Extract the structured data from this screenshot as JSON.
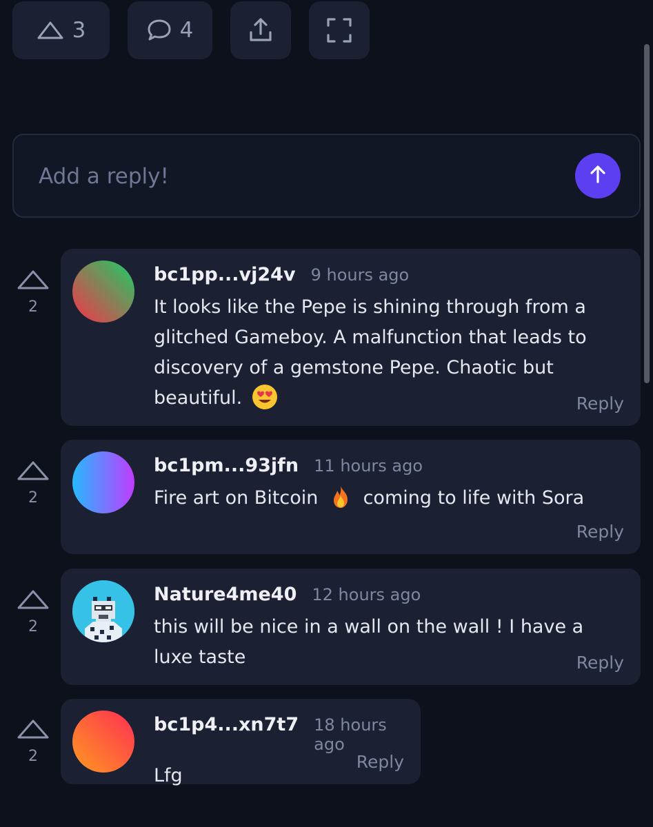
{
  "toolbar": {
    "upvote_count": "3",
    "comment_count": "4"
  },
  "reply_box": {
    "placeholder": "Add a reply!"
  },
  "comments": [
    {
      "votes": "2",
      "user": "bc1pp...vj24v",
      "time": "9 hours ago",
      "lines": [
        "It looks like the Pepe is shining through from a",
        "glitched Gameboy. A malfunction that leads to",
        "discovery of a gemstone Pepe. Chaotic but",
        "beautiful."
      ],
      "emoji": "smiling-face-with-heart-eyes",
      "reply_label": "Reply",
      "avatar_colors": [
        "#2fbf63",
        "#e4414b"
      ]
    },
    {
      "votes": "2",
      "user": "bc1pm...93jfn",
      "time": "11 hours ago",
      "text_before": "Fire art on Bitcoin",
      "emoji": "fire",
      "text_after": "coming to life with Sora",
      "reply_label": "Reply",
      "avatar_colors": [
        "#27b9ff",
        "#c03cff"
      ]
    },
    {
      "votes": "2",
      "user": "Nature4me40",
      "time": "12 hours ago",
      "lines": [
        "this will be nice in a wall on the wall !  I have a",
        "luxe taste"
      ],
      "reply_label": "Reply",
      "avatar_colors": [
        "#35c2e6",
        "#1d2a44"
      ]
    },
    {
      "votes": "2",
      "user": "bc1p4...xn7t7",
      "time": "18 hours ago",
      "lines": [
        "Lfg"
      ],
      "reply_label": "Reply",
      "avatar_colors": [
        "#ff9a1f",
        "#ff2d55"
      ]
    }
  ],
  "colors": {
    "background": "#0d111c",
    "card": "#1b2033",
    "accent": "#5b3ff0",
    "muted_text": "#7f87a0"
  }
}
